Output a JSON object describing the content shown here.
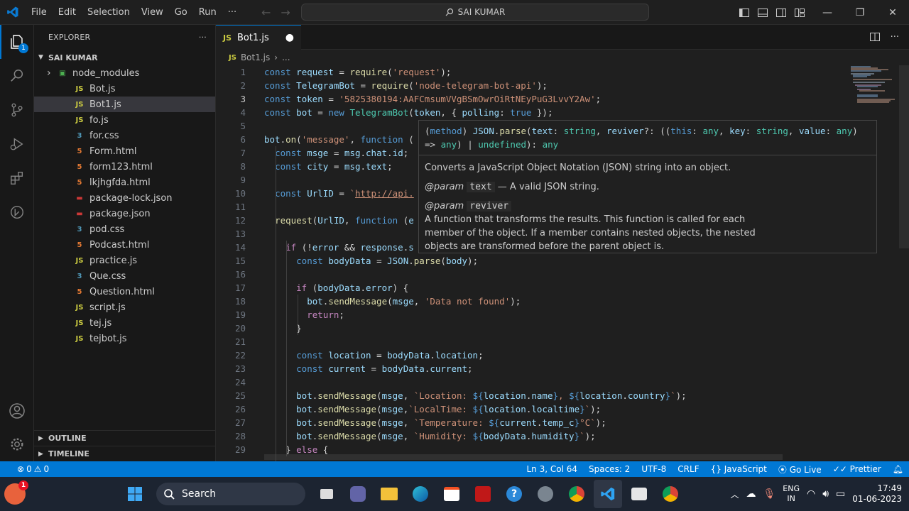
{
  "titlebar": {
    "menu": [
      "File",
      "Edit",
      "Selection",
      "View",
      "Go",
      "Run",
      "···"
    ],
    "search": "SAI KUMAR"
  },
  "activity": {
    "explorer_badge": "1"
  },
  "sidebar": {
    "header": "EXPLORER",
    "more": "···",
    "folder": "SAI KUMAR",
    "items": [
      {
        "name": "node_modules",
        "icon": "folder-icon",
        "type": "folder",
        "color": "#4caf50"
      },
      {
        "name": "Bot.js",
        "icon": "js-file-icon",
        "type": "js",
        "color": "#cbcb41"
      },
      {
        "name": "Bot1.js",
        "icon": "js-file-icon",
        "type": "js",
        "color": "#cbcb41",
        "selected": true
      },
      {
        "name": "fo.js",
        "icon": "js-file-icon",
        "type": "js",
        "color": "#cbcb41"
      },
      {
        "name": "for.css",
        "icon": "css-file-icon",
        "type": "css",
        "color": "#519aba"
      },
      {
        "name": "Form.html",
        "icon": "html-file-icon",
        "type": "html",
        "color": "#e37933"
      },
      {
        "name": "form123.html",
        "icon": "html-file-icon",
        "type": "html",
        "color": "#e37933"
      },
      {
        "name": "lkjhgfda.html",
        "icon": "html-file-icon",
        "type": "html",
        "color": "#e37933"
      },
      {
        "name": "package-lock.json",
        "icon": "npm-icon",
        "type": "npm",
        "color": "#cb3837"
      },
      {
        "name": "package.json",
        "icon": "npm-icon",
        "type": "npm",
        "color": "#cb3837"
      },
      {
        "name": "pod.css",
        "icon": "css-file-icon",
        "type": "css",
        "color": "#519aba"
      },
      {
        "name": "Podcast.html",
        "icon": "html-file-icon",
        "type": "html",
        "color": "#e37933"
      },
      {
        "name": "practice.js",
        "icon": "js-file-icon",
        "type": "js",
        "color": "#cbcb41"
      },
      {
        "name": "Que.css",
        "icon": "css-file-icon",
        "type": "css",
        "color": "#519aba"
      },
      {
        "name": "Question.html",
        "icon": "html-file-icon",
        "type": "html",
        "color": "#e37933"
      },
      {
        "name": "script.js",
        "icon": "js-file-icon",
        "type": "js",
        "color": "#cbcb41"
      },
      {
        "name": "tej.js",
        "icon": "js-file-icon",
        "type": "js",
        "color": "#cbcb41"
      },
      {
        "name": "tejbot.js",
        "icon": "js-file-icon",
        "type": "js",
        "color": "#cbcb41"
      }
    ],
    "outline": "OUTLINE",
    "timeline": "TIMELINE"
  },
  "editor": {
    "tab_label": "Bot1.js",
    "tab_lang": "JS",
    "breadcrumb_file": "Bot1.js",
    "breadcrumb_more": "...",
    "current_line": 3,
    "lines": [
      {
        "n": 1,
        "html": "<span class='k'>const</span> <span class='v'>request</span> = <span class='f'>require</span>(<span class='s'>'request'</span>);"
      },
      {
        "n": 2,
        "html": "<span class='k'>const</span> <span class='v'>TelegramBot</span> = <span class='f'>require</span>(<span class='s'>'node-telegram-bot-api'</span>);"
      },
      {
        "n": 3,
        "html": "<span class='k'>const</span> <span class='v'>token</span> = <span class='s'>'5825380194:AAFCmsumVVgBSmOwrOiRtNEyPuG3LvvY2Aw'</span>;"
      },
      {
        "n": 4,
        "html": "<span class='k'>const</span> <span class='v'>bot</span> = <span class='k'>new</span> <span class='t'>TelegramBot</span>(<span class='v'>token</span>, { <span class='v'>polling</span>: <span class='k'>true</span> });"
      },
      {
        "n": 5,
        "html": ""
      },
      {
        "n": 6,
        "html": "<span class='v'>bot</span>.<span class='f'>on</span>(<span class='s'>'message'</span>, <span class='k'>function</span> ("
      },
      {
        "n": 7,
        "html": "  <span class='k'>const</span> <span class='v'>msge</span> = <span class='v'>msg</span>.<span class='v'>chat</span>.<span class='v'>id</span>;"
      },
      {
        "n": 8,
        "html": "  <span class='k'>const</span> <span class='v'>city</span> = <span class='v'>msg</span>.<span class='v'>text</span>;"
      },
      {
        "n": 9,
        "html": ""
      },
      {
        "n": 10,
        "html": "  <span class='k'>const</span> <span class='v'>UrlID</span> = <span class='s'>`<u>http://api.</u></span>"
      },
      {
        "n": 11,
        "html": ""
      },
      {
        "n": 12,
        "html": "  <span class='f'>request</span>(<span class='v'>UrlID</span>, <span class='k'>function</span> (<span class='v'>e</span>"
      },
      {
        "n": 13,
        "html": ""
      },
      {
        "n": 14,
        "html": "    <span class='c'>if</span> (!<span class='v'>error</span> &amp;&amp; <span class='v'>response</span>.<span class='v'>s</span>"
      },
      {
        "n": 15,
        "html": "      <span class='k'>const</span> <span class='v'>bodyData</span> = <span class='v'>JSON</span>.<span class='f'>parse</span>(<span class='v'>body</span>);"
      },
      {
        "n": 16,
        "html": ""
      },
      {
        "n": 17,
        "html": "      <span class='c'>if</span> (<span class='v'>bodyData</span>.<span class='v'>error</span>) {"
      },
      {
        "n": 18,
        "html": "        <span class='v'>bot</span>.<span class='f'>sendMessage</span>(<span class='v'>msge</span>, <span class='s'>'Data not found'</span>);"
      },
      {
        "n": 19,
        "html": "        <span class='c'>return</span>;"
      },
      {
        "n": 20,
        "html": "      }"
      },
      {
        "n": 21,
        "html": ""
      },
      {
        "n": 22,
        "html": "      <span class='k'>const</span> <span class='v'>location</span> = <span class='v'>bodyData</span>.<span class='v'>location</span>;"
      },
      {
        "n": 23,
        "html": "      <span class='k'>const</span> <span class='v'>current</span> = <span class='v'>bodyData</span>.<span class='v'>current</span>;"
      },
      {
        "n": 24,
        "html": ""
      },
      {
        "n": 25,
        "html": "      <span class='v'>bot</span>.<span class='f'>sendMessage</span>(<span class='v'>msge</span>, <span class='s'>`Location: </span><span class='k'>${</span><span class='v'>location</span>.<span class='v'>name</span><span class='k'>}</span><span class='s'>, </span><span class='k'>${</span><span class='v'>location</span>.<span class='v'>country</span><span class='k'>}</span><span class='s'>`</span>);"
      },
      {
        "n": 26,
        "html": "      <span class='v'>bot</span>.<span class='f'>sendMessage</span>(<span class='v'>msge</span>,<span class='s'>`LocalTime: </span><span class='k'>${</span><span class='v'>location</span>.<span class='v'>localtime</span><span class='k'>}</span><span class='s'>`</span>);"
      },
      {
        "n": 27,
        "html": "      <span class='v'>bot</span>.<span class='f'>sendMessage</span>(<span class='v'>msge</span>, <span class='s'>`Temperature: </span><span class='k'>${</span><span class='v'>current</span>.<span class='v'>temp_c</span><span class='k'>}</span><span class='s'>°C`</span>);"
      },
      {
        "n": 28,
        "html": "      <span class='v'>bot</span>.<span class='f'>sendMessage</span>(<span class='v'>msge</span>, <span class='s'>`Humidity: </span><span class='k'>${</span><span class='v'>bodyData</span>.<span class='v'>humidity</span><span class='k'>}</span><span class='s'>`</span>);"
      },
      {
        "n": 29,
        "html": "    } <span class='c'>else</span> {"
      }
    ]
  },
  "hover": {
    "signature_html": "(<span class='k'>method</span>) <span class='v'>JSON</span>.<span class='f'>parse</span>(<span class='v'>text</span>: <span class='t'>string</span>, <span class='v'>reviver</span>?: ((<span class='k'>this</span>: <span class='t'>any</span>, <span class='v'>key</span>: <span class='t'>string</span>, <span class='v'>value</span>: <span class='t'>any</span>)<br>=&gt; <span class='t'>any</span>) | <span class='t'>undefined</span>): <span class='t'>any</span>",
    "description": "Converts a JavaScript Object Notation (JSON) string into an object.",
    "param1_tag": "@param",
    "param1_name": "text",
    "param1_desc": "— A valid JSON string.",
    "param2_tag": "@param",
    "param2_name": "reviver",
    "param2_desc": "A function that transforms the results. This function is called for each member of the object. If a member contains nested objects, the nested objects are transformed before the parent object is."
  },
  "status": {
    "errors": "0",
    "warnings": "0",
    "position": "Ln 3, Col 64",
    "spaces": "Spaces: 2",
    "encoding": "UTF-8",
    "eol": "CRLF",
    "language": "JavaScript",
    "golive": "Go Live",
    "prettier": "Prettier"
  },
  "taskbar": {
    "search": "Search",
    "lang1": "ENG",
    "lang2": "IN",
    "time": "17:49",
    "date": "01-06-2023",
    "notif": "1"
  }
}
